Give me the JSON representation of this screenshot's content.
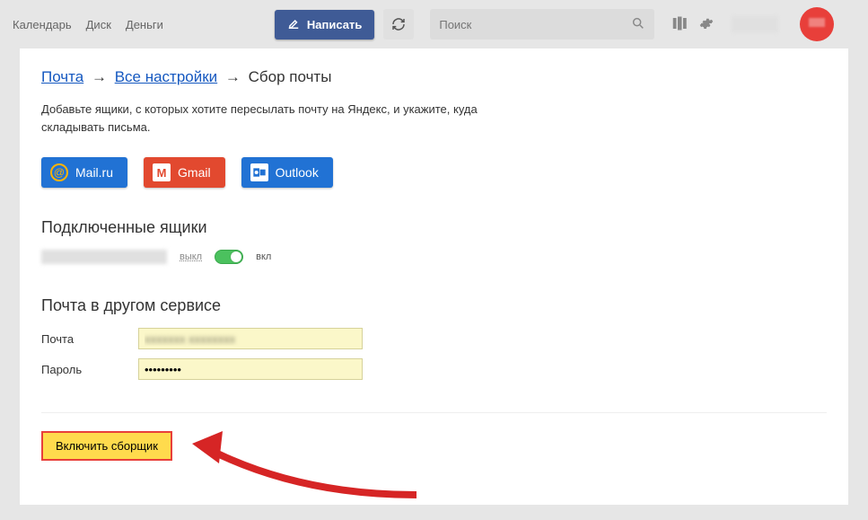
{
  "topbar": {
    "nav": [
      "Календарь",
      "Диск",
      "Деньги"
    ],
    "compose": "Написать",
    "search_placeholder": "Поиск"
  },
  "breadcrumb": {
    "mail": "Почта",
    "all_settings": "Все настройки",
    "current": "Сбор почты"
  },
  "description": "Добавьте ящики, с которых хотите пересылать почту на Яндекс, и укажите, куда складывать письма.",
  "providers": {
    "mailru": "Mail.ru",
    "gmail": "Gmail",
    "outlook": "Outlook"
  },
  "connected": {
    "heading": "Подключенные ящики",
    "off": "выкл",
    "on": "вкл"
  },
  "other_service": {
    "heading": "Почта в другом сервисе",
    "email_label": "Почта",
    "password_label": "Пароль",
    "password_value": "•••••••••"
  },
  "enable_button": "Включить сборщик"
}
